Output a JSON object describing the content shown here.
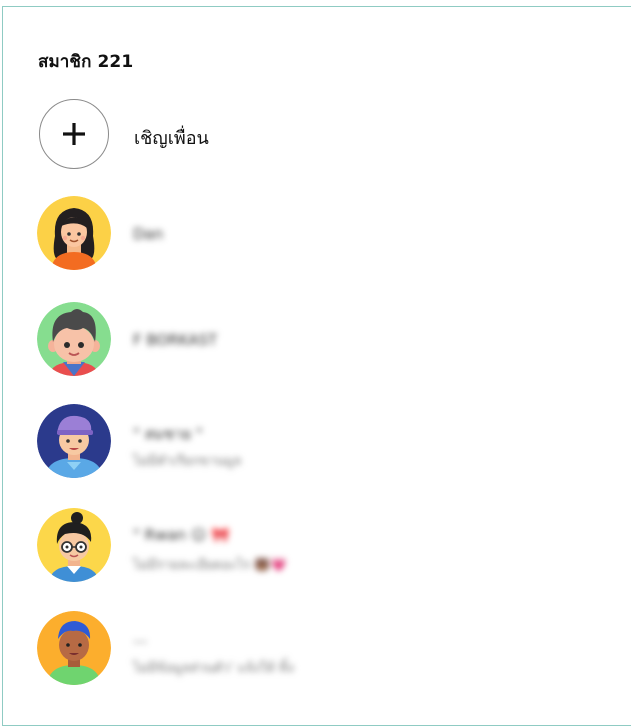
{
  "header": {
    "member_count": "สมาชิก 221"
  },
  "invite": {
    "label": "เชิญเพื่อน",
    "icon": "plus-icon"
  },
  "members": [
    {
      "name": "Dan"
    },
    {
      "name": "F BORKAST"
    },
    {
      "name": "\" สมชาย \"",
      "status": "ไม่มีคำเรียกขานมูล"
    },
    {
      "name": "\" Rwan  ☺ 🎀",
      "status": "ไม่มีรายละเอียดอะไร 🐻💗"
    },
    {
      "name": "...",
      "status": "ไม่มีข้อมูลส่วนตัว' แจ้งให้ ทิ้ง"
    }
  ]
}
